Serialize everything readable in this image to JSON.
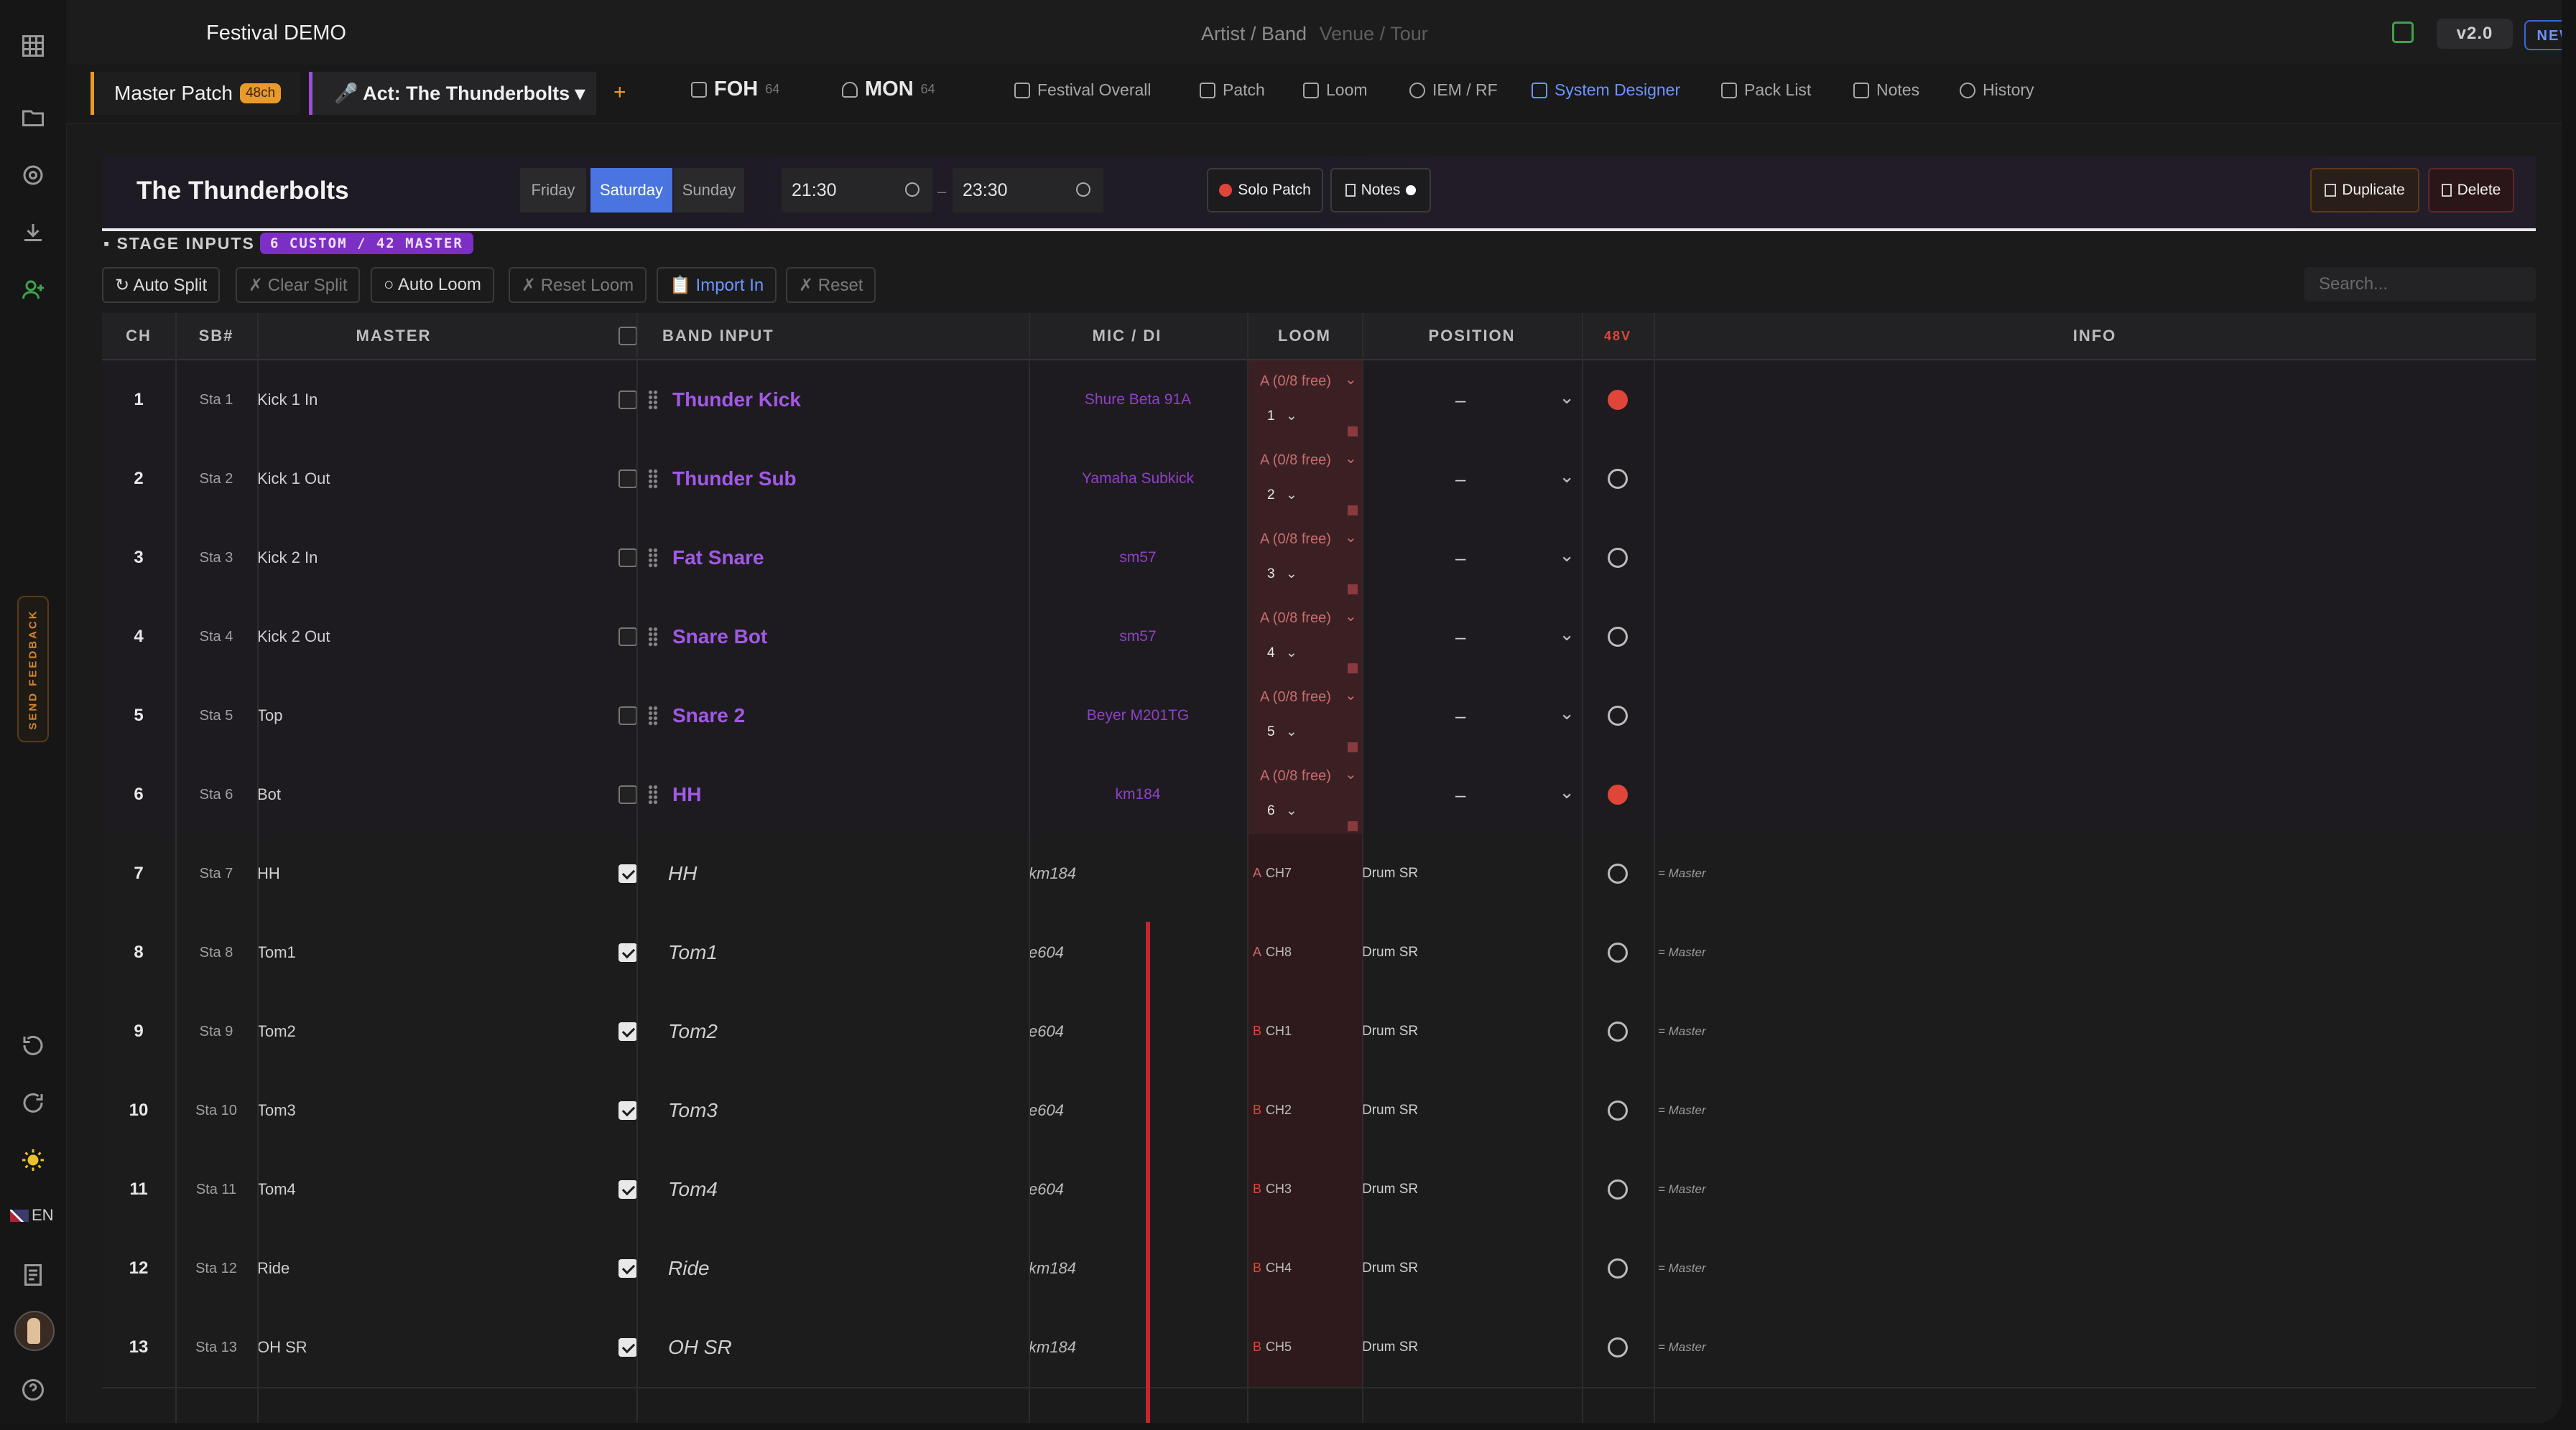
{
  "app": {
    "title": "Festival DEMO",
    "crumb_main": "Artist / Band",
    "crumb_dim": "Venue / Tour",
    "version": "v2.0",
    "new_badge": "NEW ✦"
  },
  "rail": {
    "feedback": "SEND FEEDBACK",
    "lang": "EN"
  },
  "nav": {
    "master_patch": "Master Patch",
    "master_badge": "48ch",
    "act": "🎤 Act: The Thunderbolts ▾",
    "plus": "+",
    "foh": "FOH",
    "foh_count": "64",
    "mon": "MON",
    "mon_count": "64",
    "items": [
      "Festival Overall",
      "Patch",
      "Loom",
      "IEM / RF",
      "System Designer",
      "Pack List",
      "Notes",
      "History"
    ]
  },
  "act": {
    "name": "The Thunderbolts",
    "days": [
      "Friday",
      "Saturday",
      "Sunday"
    ],
    "selected_day": "Saturday",
    "start": "21:30",
    "end": "23:30",
    "dash": "–",
    "solo_patch": "Solo Patch",
    "notes": "Notes",
    "duplicate": "Duplicate",
    "delete": "Delete"
  },
  "stage": {
    "label": "▪ STAGE INPUTS",
    "badge": "6 CUSTOM / 42 MASTER",
    "buttons": [
      "↻ Auto Split",
      "✗ Clear Split",
      "○ Auto Loom",
      "✗ Reset Loom",
      "📋 Import In",
      "✗ Reset"
    ],
    "search_placeholder": "Search..."
  },
  "table": {
    "headers": {
      "ch": "CH",
      "sb": "SB#",
      "master": "MASTER",
      "band": "BAND INPUT",
      "mic": "MIC / DI",
      "loom": "LOOM",
      "position": "POSITION",
      "v48": "48V",
      "info": "INFO"
    },
    "rows": [
      {
        "ch": "1",
        "sb": "Sta 1",
        "master": "Kick 1 In",
        "checked": false,
        "band": "Thunder Kick",
        "mic": "Shure Beta 91A",
        "loom": "A (0/8 free)",
        "loom_sel": "1",
        "position": "–",
        "v48": true,
        "info": "",
        "custom": true
      },
      {
        "ch": "2",
        "sb": "Sta 2",
        "master": "Kick 1 Out",
        "checked": false,
        "band": "Thunder Sub",
        "mic": "Yamaha Subkick",
        "loom": "A (0/8 free)",
        "loom_sel": "2",
        "position": "–",
        "v48": false,
        "info": "",
        "custom": true
      },
      {
        "ch": "3",
        "sb": "Sta 3",
        "master": "Kick 2 In",
        "checked": false,
        "band": "Fat Snare",
        "mic": "sm57",
        "loom": "A (0/8 free)",
        "loom_sel": "3",
        "position": "–",
        "v48": false,
        "info": "",
        "custom": true
      },
      {
        "ch": "4",
        "sb": "Sta 4",
        "master": "Kick 2 Out",
        "checked": false,
        "band": "Snare Bot",
        "mic": "sm57",
        "loom": "A (0/8 free)",
        "loom_sel": "4",
        "position": "–",
        "v48": false,
        "info": "",
        "custom": true
      },
      {
        "ch": "5",
        "sb": "Sta 5",
        "master": "Top",
        "checked": false,
        "band": "Snare 2",
        "mic": "Beyer M201TG",
        "loom": "A (0/8 free)",
        "loom_sel": "5",
        "position": "–",
        "v48": false,
        "info": "",
        "custom": true
      },
      {
        "ch": "6",
        "sb": "Sta 6",
        "master": "Bot",
        "checked": false,
        "band": "HH",
        "mic": "km184",
        "loom": "A (0/8 free)",
        "loom_sel": "6",
        "position": "–",
        "v48": true,
        "info": "",
        "custom": true
      },
      {
        "ch": "7",
        "sb": "Sta 7",
        "master": "HH",
        "checked": true,
        "band": "HH",
        "mic": "km184",
        "loom_prefix": "A",
        "loom": "CH7",
        "position": "Drum SR",
        "v48": false,
        "info": "= Master",
        "custom": false
      },
      {
        "ch": "8",
        "sb": "Sta 8",
        "master": "Tom1",
        "checked": true,
        "band": "Tom1",
        "mic": "e604",
        "loom_prefix": "A",
        "loom": "CH8",
        "position": "Drum SR",
        "v48": false,
        "info": "= Master",
        "custom": false
      },
      {
        "ch": "9",
        "sb": "Sta 9",
        "master": "Tom2",
        "checked": true,
        "band": "Tom2",
        "mic": "e604",
        "loom_prefix": "B",
        "loom": "CH1",
        "position": "Drum SR",
        "v48": false,
        "info": "= Master",
        "custom": false
      },
      {
        "ch": "10",
        "sb": "Sta 10",
        "master": "Tom3",
        "checked": true,
        "band": "Tom3",
        "mic": "e604",
        "loom_prefix": "B",
        "loom": "CH2",
        "position": "Drum SR",
        "v48": false,
        "info": "= Master",
        "custom": false
      },
      {
        "ch": "11",
        "sb": "Sta 11",
        "master": "Tom4",
        "checked": true,
        "band": "Tom4",
        "mic": "e604",
        "loom_prefix": "B",
        "loom": "CH3",
        "position": "Drum SR",
        "v48": false,
        "info": "= Master",
        "custom": false
      },
      {
        "ch": "12",
        "sb": "Sta 12",
        "master": "Ride",
        "checked": true,
        "band": "Ride",
        "mic": "km184",
        "loom_prefix": "B",
        "loom": "CH4",
        "position": "Drum SR",
        "v48": false,
        "info": "= Master",
        "custom": false
      },
      {
        "ch": "13",
        "sb": "Sta 13",
        "master": "OH SR",
        "checked": true,
        "band": "OH SR",
        "mic": "km184",
        "loom_prefix": "B",
        "loom": "CH5",
        "position": "Drum SR",
        "v48": false,
        "info": "= Master",
        "custom": false
      }
    ]
  }
}
